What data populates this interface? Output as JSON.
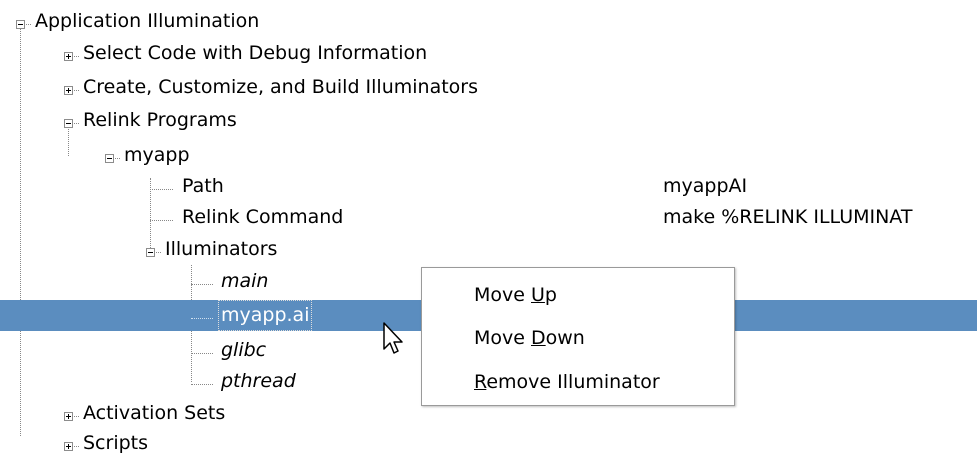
{
  "tree": {
    "root": "Application Illumination",
    "select_code": "Select Code with Debug Information",
    "create": "Create, Customize, and Build Illuminators",
    "relink": "Relink Programs",
    "myapp": "myapp",
    "path_label": "Path",
    "path_value": "myappAI",
    "relink_cmd_label": "Relink Command",
    "relink_cmd_value": "make %RELINK ILLUMINAT",
    "illuminators": "Illuminators",
    "ill_main": "main",
    "ill_myapp": "myapp.ai",
    "ill_glibc": "glibc",
    "ill_pthread": "pthread",
    "activation": "Activation Sets",
    "scripts": "Scripts"
  },
  "context_menu": {
    "move_up_pre": "Move ",
    "move_up_key": "U",
    "move_up_post": "p",
    "move_down_pre": "Move ",
    "move_down_key": "D",
    "move_down_post": "own",
    "remove_key": "R",
    "remove_post": "emove Illuminator"
  },
  "colors": {
    "selection": "#5b8dbf"
  },
  "icons": {
    "expand": "plus-box",
    "collapse": "minus-box",
    "cursor": "arrow-pointer"
  }
}
